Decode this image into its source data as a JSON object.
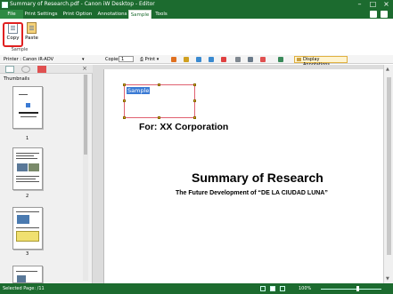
{
  "window": {
    "title": "Summary of Research.pdf - Canon iW Desktop - Editor"
  },
  "menubar": {
    "tabs": [
      {
        "label": "File"
      },
      {
        "label": "Print Settings"
      },
      {
        "label": "Print Option"
      },
      {
        "label": "Annotations"
      },
      {
        "label": "Sample"
      },
      {
        "label": "Tools"
      }
    ],
    "active_tab": "Sample"
  },
  "ribbon": {
    "copy_label": "Copy",
    "paste_label": "Paste",
    "group_label": "Sample"
  },
  "print_toolbar": {
    "printer_label": "Printer : Canon iR-ADV",
    "copies_label": "Copies",
    "copies_value": "1",
    "print_label": "Print",
    "display_annotations_label": "Display Annotations"
  },
  "left_pane": {
    "header": "Thumbnails",
    "pages": [
      {
        "number": "1"
      },
      {
        "number": "2"
      },
      {
        "number": "3"
      }
    ]
  },
  "document": {
    "annotation_text": "Sample",
    "for_line": "For: XX Corporation",
    "title": "Summary of Research",
    "subtitle": "The Future Development of “DE LA CIUDAD LUNA”"
  },
  "statusbar": {
    "selected_page": "Selected Page: /11",
    "zoom": "100%"
  },
  "colors": {
    "brand_green": "#1c6b2f",
    "highlight_red": "#e02020",
    "annotation_border": "#e06070"
  }
}
